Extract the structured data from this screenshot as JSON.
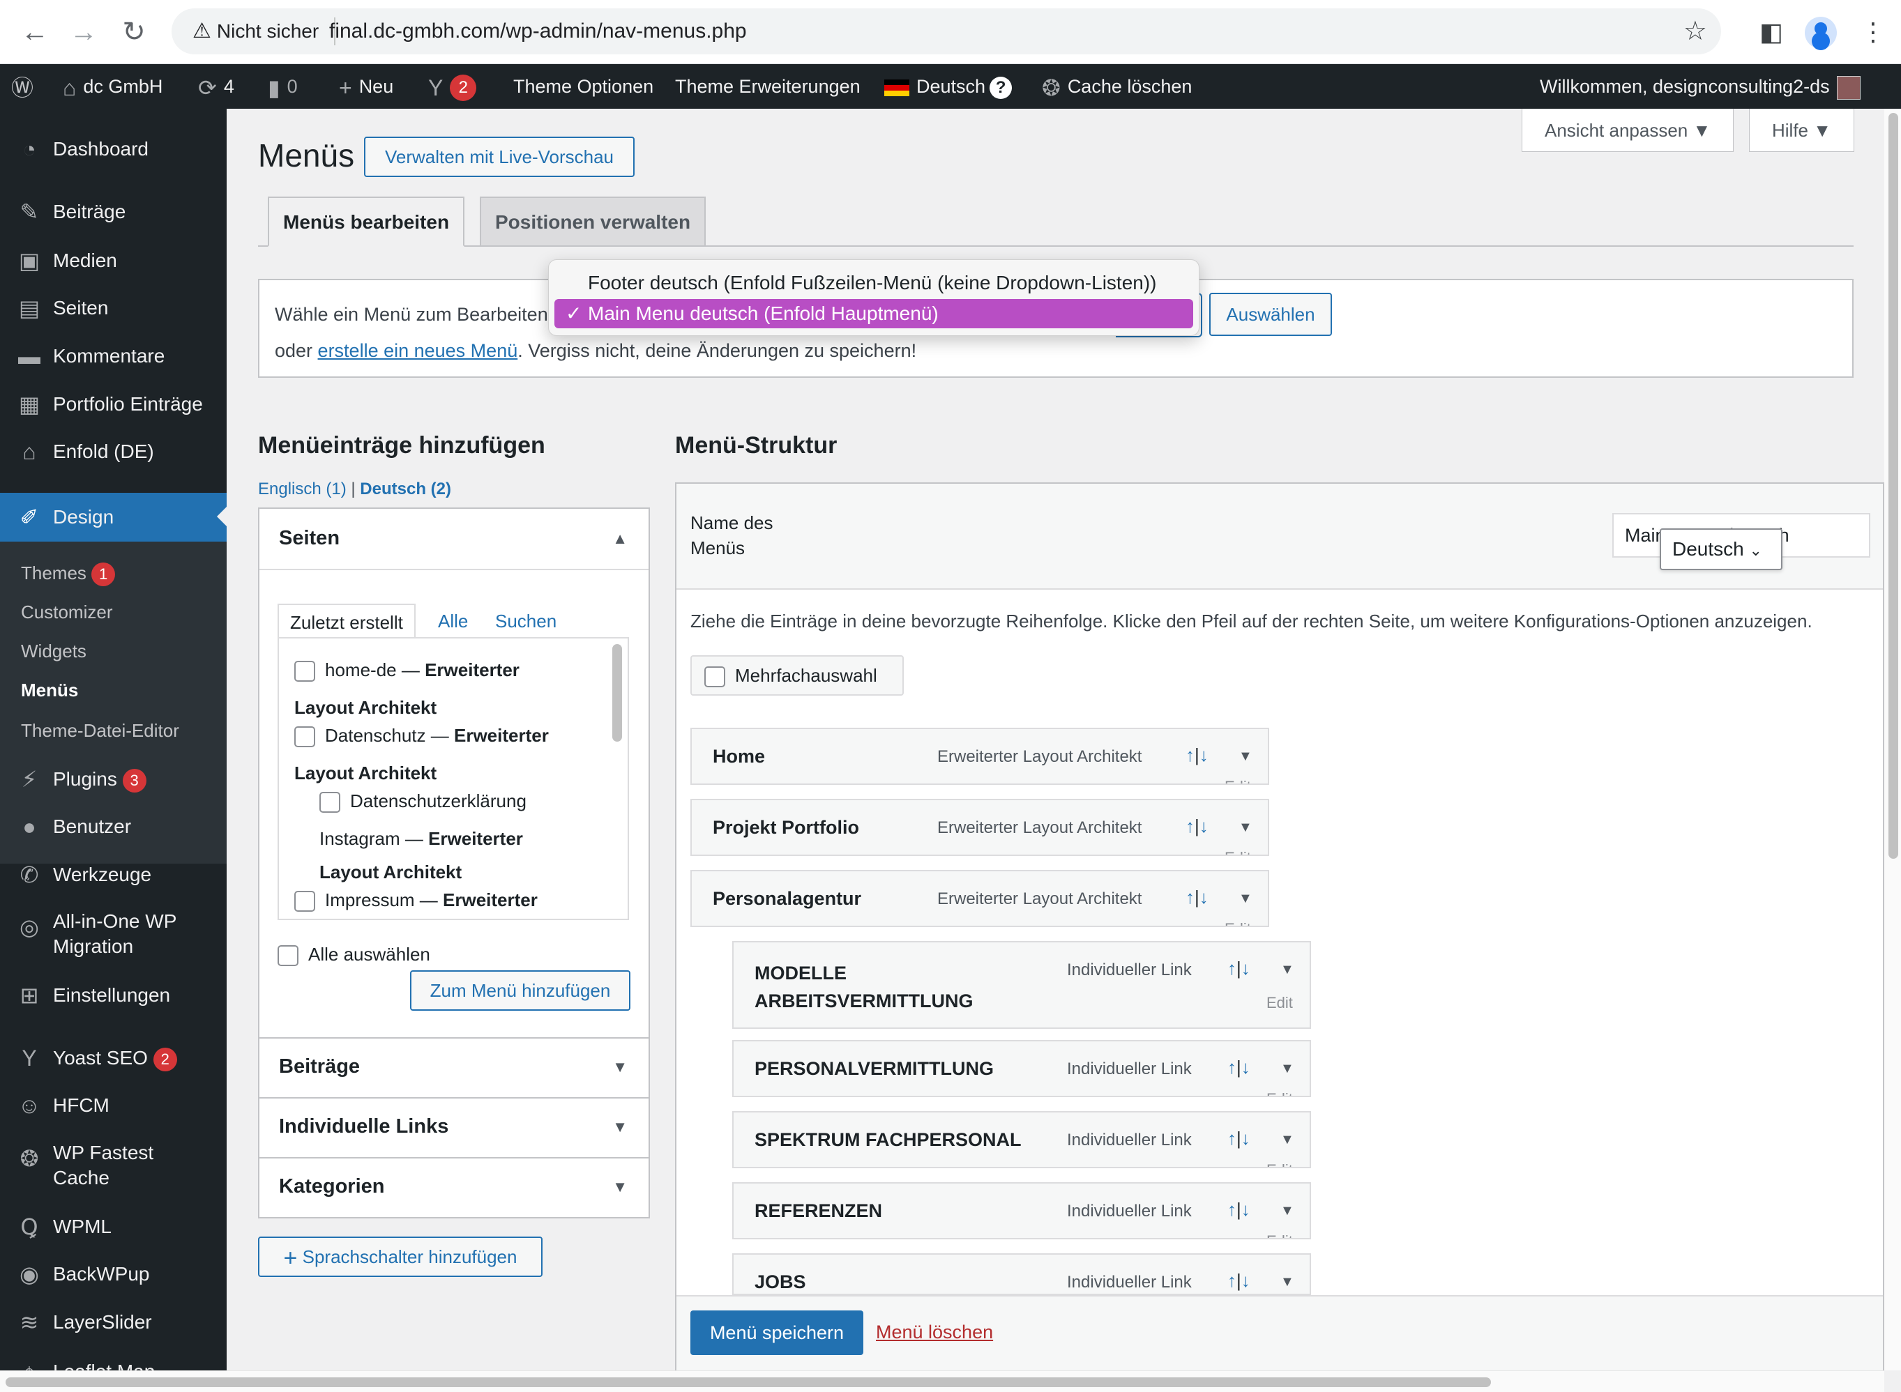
{
  "browser": {
    "security_label": "Nicht sicher",
    "url": "final.dc-gmbh.com/wp-admin/nav-menus.php"
  },
  "adminbar": {
    "site": "dc GmbH",
    "updates_count": "4",
    "comments_count": "0",
    "new_label": "Neu",
    "yoast_count": "2",
    "theme_options": "Theme Optionen",
    "theme_extensions": "Theme Erweiterungen",
    "language": "Deutsch",
    "language_help": "?",
    "cache_clear": "Cache löschen",
    "welcome": "Willkommen, designconsulting2-ds"
  },
  "sidebar": {
    "items": [
      {
        "label": "Dashboard",
        "icon": "dashboard-icon"
      },
      {
        "label": "Beiträge",
        "icon": "pin-icon"
      },
      {
        "label": "Medien",
        "icon": "media-icon"
      },
      {
        "label": "Seiten",
        "icon": "pages-icon"
      },
      {
        "label": "Kommentare",
        "icon": "comment-icon"
      },
      {
        "label": "Portfolio Einträge",
        "icon": "portfolio-icon"
      },
      {
        "label": "Enfold (DE)",
        "icon": "house-icon"
      },
      {
        "label": "Design",
        "icon": "brush-icon"
      },
      {
        "label": "Plugins",
        "icon": "plug-icon",
        "badge": "3"
      },
      {
        "label": "Benutzer",
        "icon": "user-icon"
      },
      {
        "label": "Werkzeuge",
        "icon": "wrench-icon"
      },
      {
        "label": "All-in-One WP",
        "label2": "Migration",
        "icon": "migration-icon"
      },
      {
        "label": "Einstellungen",
        "icon": "settings-icon"
      },
      {
        "label": "Yoast SEO",
        "icon": "yoast-icon",
        "badge": "2"
      },
      {
        "label": "HFCM",
        "icon": "robot-icon"
      },
      {
        "label": "WP Fastest",
        "label2": "Cache",
        "icon": "cheetah-icon"
      },
      {
        "label": "WPML",
        "icon": "wpml-icon"
      },
      {
        "label": "BackWPup",
        "icon": "backup-icon"
      },
      {
        "label": "LayerSlider",
        "icon": "layers-icon"
      },
      {
        "label": "Leaflet Map",
        "icon": "map-icon"
      }
    ],
    "submenu": [
      {
        "label": "Themes",
        "badge": "1"
      },
      {
        "label": "Customizer"
      },
      {
        "label": "Widgets"
      },
      {
        "label": "Menüs"
      },
      {
        "label": "Theme-Datei-Editor"
      }
    ]
  },
  "header": {
    "title": "Menüs",
    "live_preview": "Verwalten mit Live-Vorschau",
    "screen_options": "Ansicht anpassen",
    "help": "Hilfe"
  },
  "tabs": [
    "Menüs bearbeiten",
    "Positionen verwalten"
  ],
  "manage": {
    "select_label": "Wähle ein Menü zum Bearbeiten:",
    "options": [
      "Footer deutsch (Enfold Fußzeilen-Menü (keine Dropdown-Listen))",
      "Main Menu deutsch (Enfold Hauptmenü)"
    ],
    "selected_check": "✓",
    "select_button": "Auswählen",
    "line2_prefix": "oder ",
    "create_link": "erstelle ein neues Menü",
    "line2_suffix": ". Vergiss nicht, deine Änderungen zu speichern!"
  },
  "add_items": {
    "title": "Menüeinträge hinzufügen",
    "lang_en": "Englisch (1)",
    "lang_sep": "|",
    "lang_de": "Deutsch (2)",
    "pages": {
      "title": "Seiten",
      "tabs": [
        "Zuletzt erstellt",
        "Alle",
        "Suchen"
      ],
      "entries": {
        "e1a": "home-de — ",
        "e1b": "Erweiterter",
        "e1c": "Layout Architekt",
        "e2a": "Datenschutz — ",
        "e2b": "Erweiterter",
        "e2c": "Layout Architekt",
        "e3": "Datenschutzerklärung",
        "e4a": "Instagram — ",
        "e4b": "Erweiterter",
        "e4c": "Layout Architekt",
        "e5a": "Impressum — ",
        "e5b": "Erweiterter"
      },
      "select_all": "Alle auswählen",
      "add_button": "Zum Menü hinzufügen"
    },
    "collapsed": [
      "Beiträge",
      "Individuelle Links",
      "Kategorien"
    ],
    "lang_switch_button": "Sprachschalter hinzufügen",
    "plus": "+"
  },
  "structure": {
    "title": "Menü-Struktur",
    "name_label_1": "Name des",
    "name_label_2": "Menüs",
    "name_value": "Main Menu deutsch",
    "lang_dropdown": "Deutsch",
    "instructions": "Ziehe die Einträge in deine bevorzugte Reihenfolge. Klicke den Pfeil auf der rechten Seite, um weitere Konfigurations-Optionen anzuzeigen.",
    "bulk_select": "Mehrfachauswahl",
    "move_up": "↑",
    "move_sep": "|",
    "move_down": "↓",
    "toggle": "▼",
    "edit": "Edit",
    "items": [
      {
        "title": "Home",
        "type": "Erweiterter Layout Architekt"
      },
      {
        "title": "Projekt Portfolio",
        "type": "Erweiterter Layout Architekt"
      },
      {
        "title": "Personalagentur",
        "type": "Erweiterter Layout Architekt"
      },
      {
        "title": "MODELLE",
        "title2": "ARBEITSVERMITTLUNG",
        "type": "Individueller Link"
      },
      {
        "title": "PERSONALVERMITTLUNG",
        "type": "Individueller Link"
      },
      {
        "title": "SPEKTRUM FACHPERSONAL",
        "type": "Individueller Link"
      },
      {
        "title": "REFERENZEN",
        "type": "Individueller Link"
      },
      {
        "title": "JOBS",
        "type": "Individueller Link"
      }
    ],
    "save_button": "Menü speichern",
    "delete_link": "Menü löschen"
  }
}
